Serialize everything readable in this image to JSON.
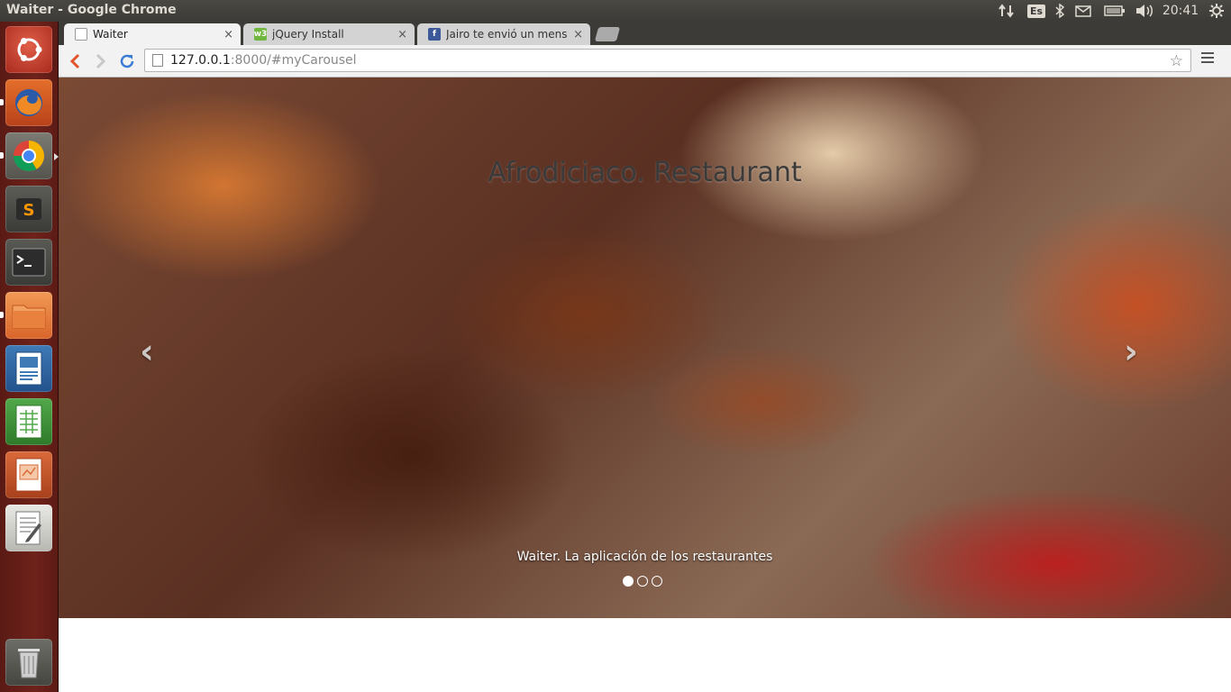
{
  "panel": {
    "window_title": "Waiter - Google Chrome",
    "keyboard_layout": "Es",
    "clock": "20:41",
    "icons": [
      "network-icon",
      "keyboard-layout-icon",
      "bluetooth-icon",
      "mail-icon",
      "battery-icon",
      "volume-icon",
      "system-gear-icon"
    ]
  },
  "launcher": {
    "items": [
      {
        "name": "ubuntu-dash",
        "icon": "ubuntu-logo-icon"
      },
      {
        "name": "firefox",
        "icon": "firefox-icon"
      },
      {
        "name": "chrome",
        "icon": "chrome-icon"
      },
      {
        "name": "sublime-text",
        "icon": "sublime-icon"
      },
      {
        "name": "terminal",
        "icon": "terminal-icon"
      },
      {
        "name": "files",
        "icon": "folder-icon"
      },
      {
        "name": "libreoffice-writer",
        "icon": "writer-icon"
      },
      {
        "name": "libreoffice-calc",
        "icon": "calc-icon"
      },
      {
        "name": "libreoffice-impress",
        "icon": "impress-icon"
      },
      {
        "name": "text-editor",
        "icon": "text-editor-icon"
      },
      {
        "name": "trash",
        "icon": "trash-icon"
      }
    ]
  },
  "browser": {
    "tabs": [
      {
        "label": "Waiter",
        "favicon": "page-icon",
        "active": true
      },
      {
        "label": "jQuery Install",
        "favicon": "w3-icon",
        "active": false
      },
      {
        "label": "Jairo te envió un mensaje",
        "favicon": "facebook-icon",
        "active": false
      }
    ],
    "close_glyph": "×",
    "url_host": "127.0.0.1",
    "url_rest": ":8000/#myCarousel"
  },
  "page": {
    "carousel_title": "Afrodiciaco. Restaurant",
    "caption": "Waiter. La aplicación de los restaurantes",
    "prev_glyph": "‹",
    "next_glyph": "›",
    "active_slide": 1,
    "slide_count": 3
  },
  "colors": {
    "panel_bg": "#3c3b37",
    "launcher_bg": "#6e221a",
    "chrome_toolbar": "#f2f2f2"
  }
}
